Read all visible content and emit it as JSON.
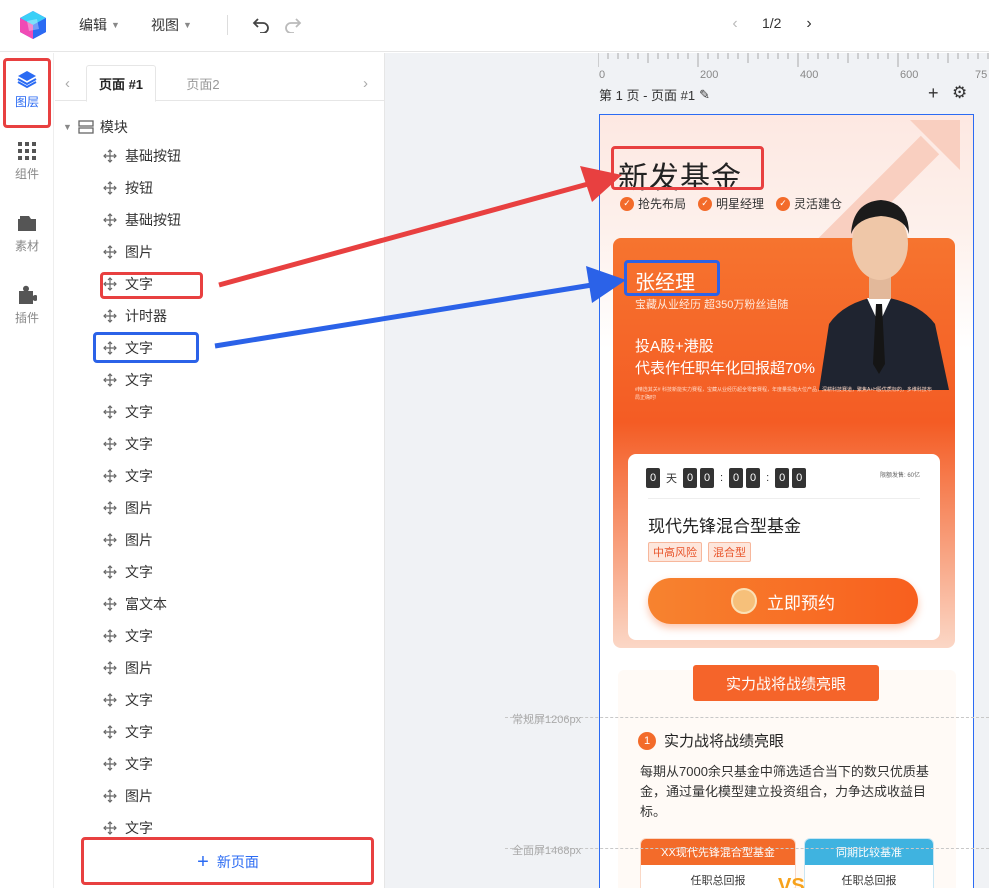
{
  "toolbar": {
    "menu_edit": "编辑",
    "menu_view": "视图",
    "pager": "1/2"
  },
  "rail": {
    "items": [
      {
        "label": "图层",
        "icon": "layers-icon",
        "active": true
      },
      {
        "label": "组件",
        "icon": "grid-icon"
      },
      {
        "label": "素材",
        "icon": "folder-icon"
      },
      {
        "label": "插件",
        "icon": "puzzle-icon"
      }
    ]
  },
  "panel": {
    "tabs": [
      {
        "label": "页面 #1",
        "active": true
      },
      {
        "label": "页面2"
      }
    ],
    "root_label": "模块",
    "items": [
      "基础按钮",
      "按钮",
      "基础按钮",
      "图片",
      "文字",
      "计时器",
      "文字",
      "文字",
      "文字",
      "文字",
      "文字",
      "图片",
      "图片",
      "文字",
      "富文本",
      "文字",
      "图片",
      "文字",
      "文字",
      "文字",
      "图片",
      "文字"
    ],
    "new_page_label": "新页面"
  },
  "canvas": {
    "ruler_ticks": [
      "0",
      "200",
      "400",
      "600",
      "75"
    ],
    "page_label": "第 1 页 - 页面 #1",
    "guide_labels": [
      "常规屏1206px",
      "全面屏1468px"
    ],
    "accent_color": "#2b6bf3",
    "annotation_red": "#e84040",
    "annotation_blue": "#2b62e8"
  },
  "page": {
    "title": "新发基金",
    "tags": [
      "抢先布局",
      "明星经理",
      "灵活建仓"
    ],
    "manager": "张经理",
    "manager_sub": "宝藏从业经历 超350万粉丝追随",
    "headline_1": "投A股+港股",
    "headline_2": "代表作任职年化回报超70%",
    "fine_print": "#精选其关# 科技新能实力赛程，宝藏从业经历超全零套赛程，年度量投指大位产品，深耕科技赛道，聚焦A+H股优质标的，多维科技布局正确时!",
    "countdown": {
      "days": [
        "0"
      ],
      "day_unit": "天",
      "hours": [
        "0",
        "0"
      ],
      "minutes": [
        "0",
        "0"
      ],
      "seconds": [
        "0",
        "0"
      ],
      "sep": ":",
      "right_note": "限额发售: 60亿"
    },
    "fund_name": "现代先锋混合型基金",
    "fund_tags": [
      "中高风险",
      "混合型"
    ],
    "cta_label": "立即预约",
    "ribbon_label": "实力战将战绩亮眼",
    "section_number": "1",
    "section_title": "实力战将战绩亮眼",
    "section_body": "每期从7000余只基金中筛选适合当下的数只优质基金，通过量化模型建立投资组合，力争达成收益目标。",
    "card_left_title": "XX现代先锋混合型基金",
    "card_left_body": "任职总回报",
    "card_right_title": "同期比较基准",
    "card_right_body": "任职总回报",
    "vs": "VS"
  }
}
